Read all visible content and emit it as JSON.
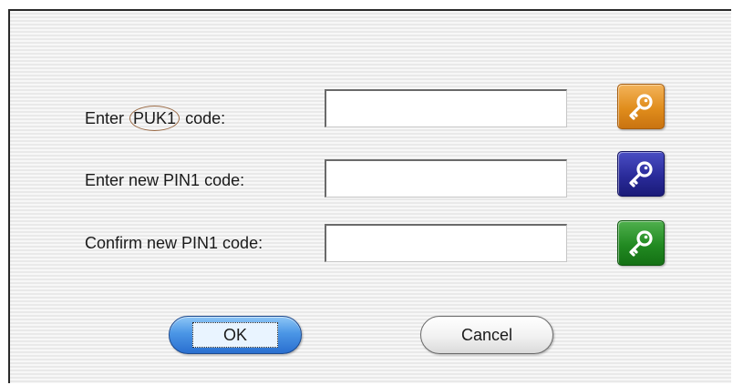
{
  "form": {
    "puk_label": {
      "prefix": "Enter ",
      "highlight": "PUK1",
      "suffix": " code:"
    },
    "new_pin_label": "Enter new PIN1 code:",
    "confirm_pin_label": "Confirm new PIN1 code:",
    "puk_value": "",
    "new_pin_value": "",
    "confirm_pin_value": ""
  },
  "key_buttons": [
    {
      "icon": "key-icon",
      "color": "#e08d1c"
    },
    {
      "icon": "key-icon",
      "color": "#2a2b9a"
    },
    {
      "icon": "key-icon",
      "color": "#228a22"
    }
  ],
  "buttons": {
    "ok_label": "OK",
    "cancel_label": "Cancel"
  }
}
